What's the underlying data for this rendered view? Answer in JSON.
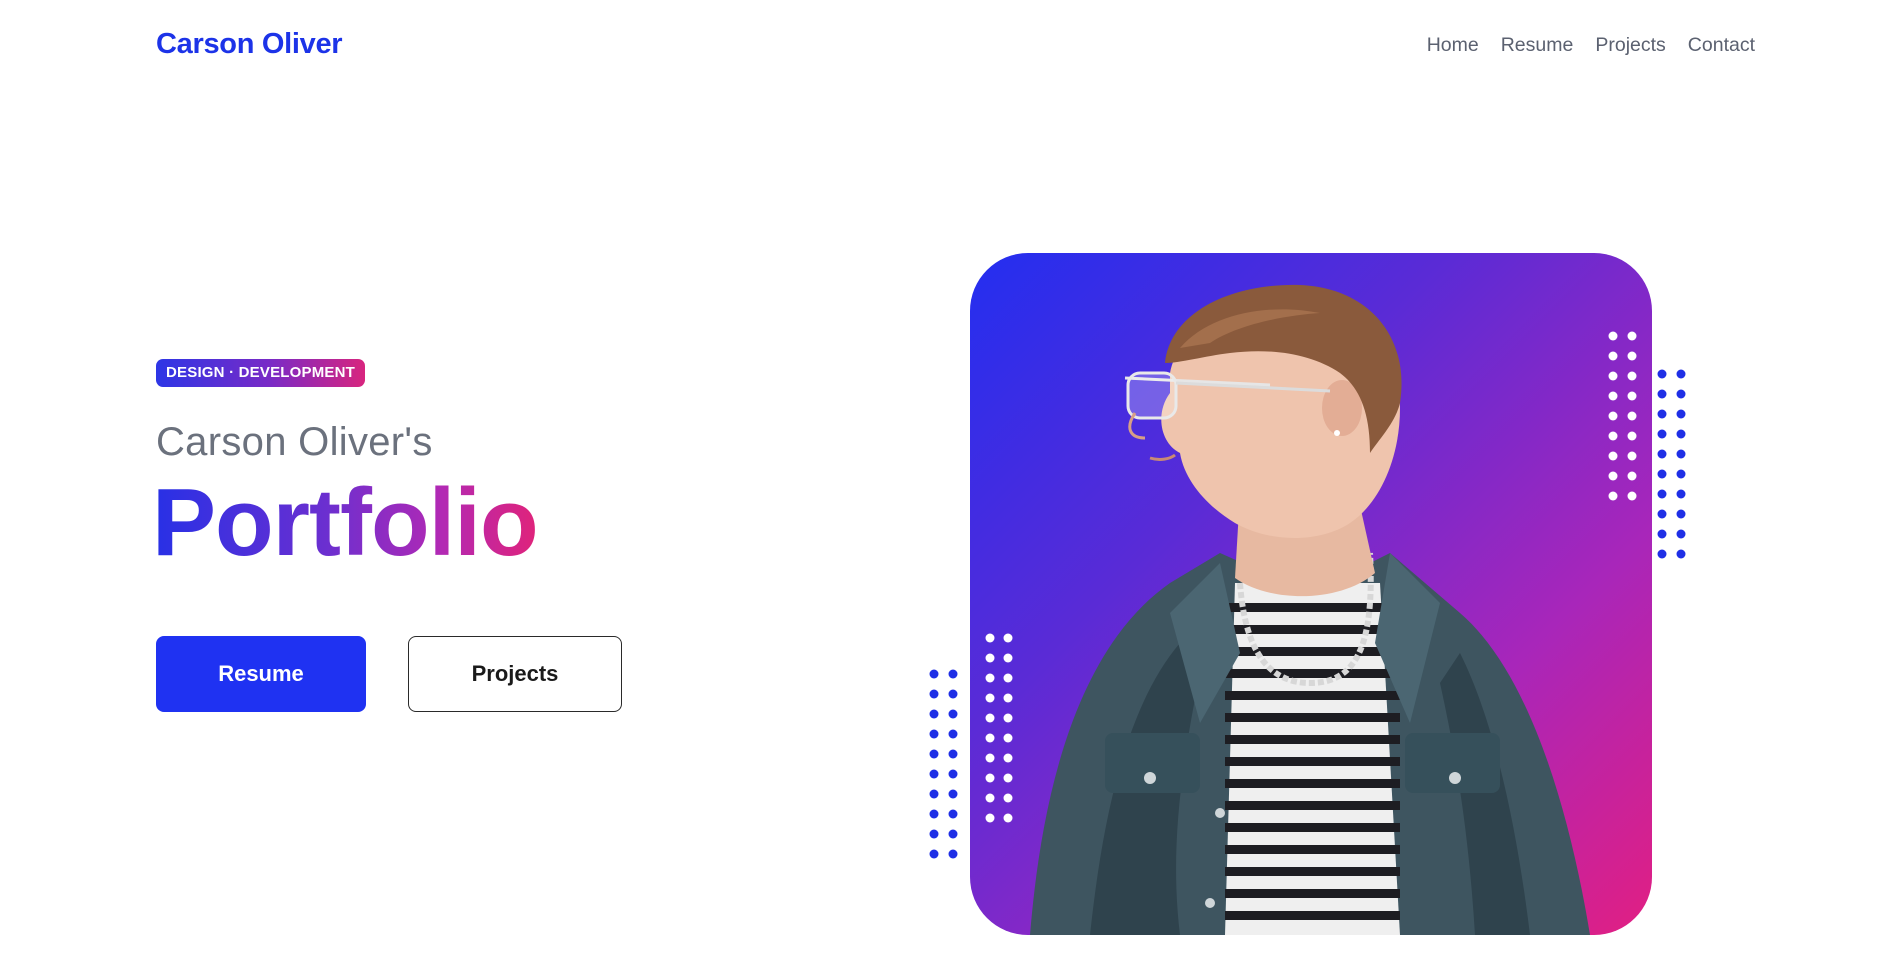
{
  "header": {
    "brand": "Carson Oliver",
    "nav": [
      {
        "label": "Home"
      },
      {
        "label": "Resume"
      },
      {
        "label": "Projects"
      },
      {
        "label": "Contact"
      }
    ]
  },
  "hero": {
    "tag": "DESIGN · DEVELOPMENT",
    "subtitle": "Carson Oliver's",
    "title": "Portfolio",
    "primary_button": "Resume",
    "secondary_button": "Projects"
  },
  "colors": {
    "brand": "#1c33e8",
    "gradient_start": "#232ef0",
    "gradient_end": "#e21f82",
    "dots_blue": "#1f2fe6",
    "dots_white": "#ffffff"
  },
  "icons": {
    "portrait": "person-portrait-image",
    "decoration": "dot-grid-pattern"
  }
}
